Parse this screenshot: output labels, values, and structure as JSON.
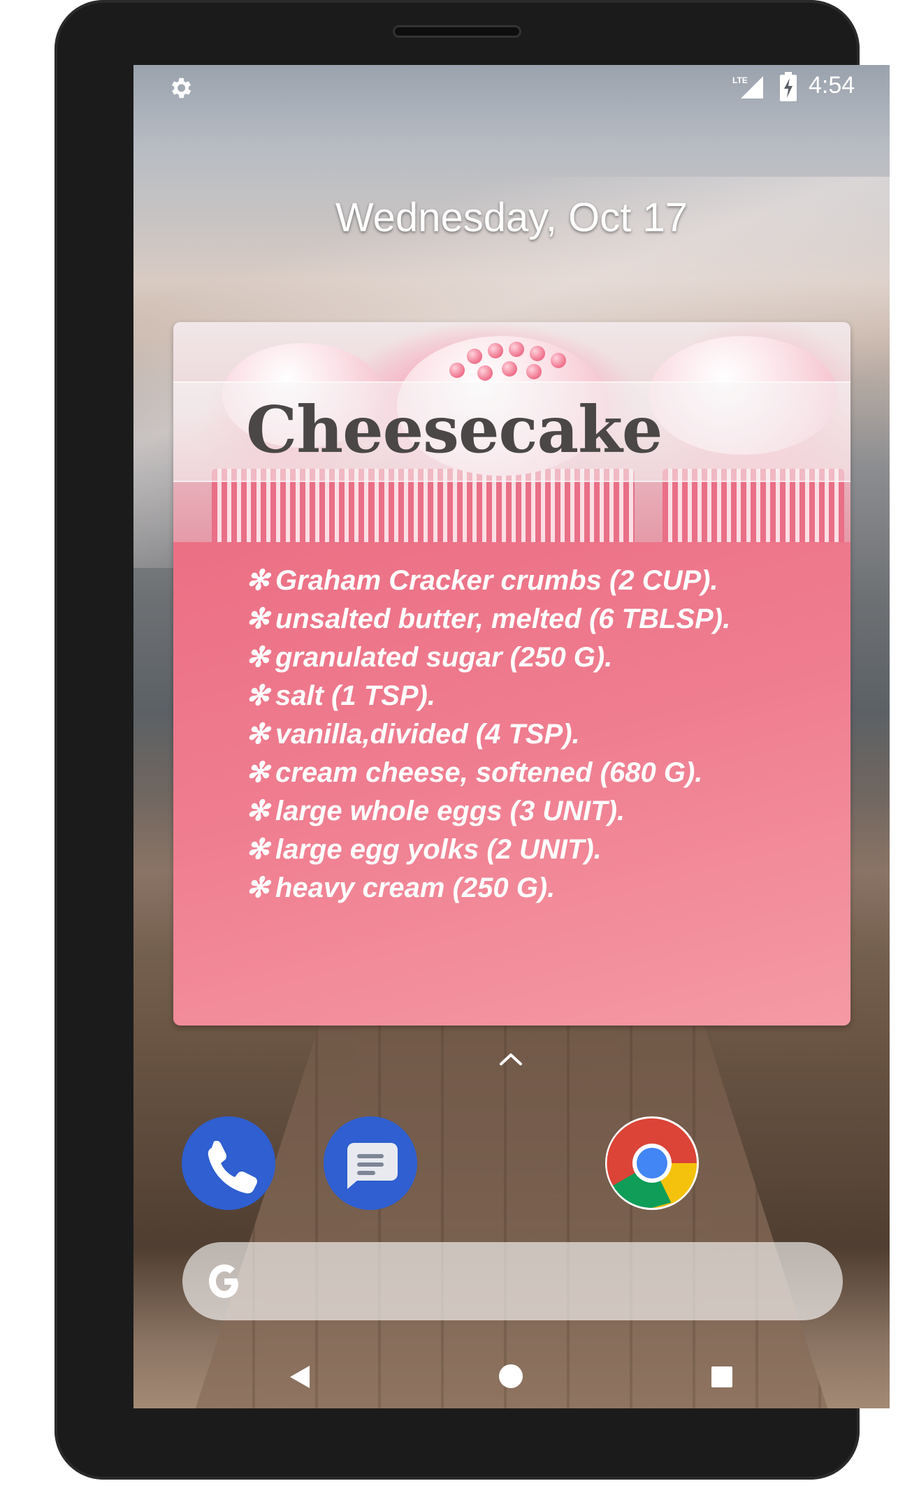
{
  "status_bar": {
    "settings_icon": "gear-icon",
    "network": "LTE",
    "battery_icon": "battery-charging-icon",
    "time": "4:54"
  },
  "lockscreen": {
    "date": "Wednesday, Oct 17"
  },
  "widget": {
    "title": "Cheesecake",
    "bullet": "✻",
    "ingredients": [
      "Graham Cracker crumbs (2 CUP).",
      "unsalted butter, melted (6 TBLSP).",
      "granulated sugar (250 G).",
      "salt (1 TSP).",
      "vanilla,divided (4 TSP).",
      "cream cheese, softened (680 G).",
      "large whole eggs (3 UNIT).",
      "large egg yolks (2 UNIT).",
      "heavy cream (250 G)."
    ],
    "colors": {
      "body": "#ec6f84",
      "title_text": "#4b4747"
    }
  },
  "dock": {
    "apps": [
      "phone-icon",
      "messages-icon",
      "chrome-icon"
    ]
  },
  "search": {
    "logo": "google-g-icon"
  },
  "nav": {
    "back": "back-triangle-icon",
    "home": "home-circle-icon",
    "recents": "recents-square-icon"
  }
}
